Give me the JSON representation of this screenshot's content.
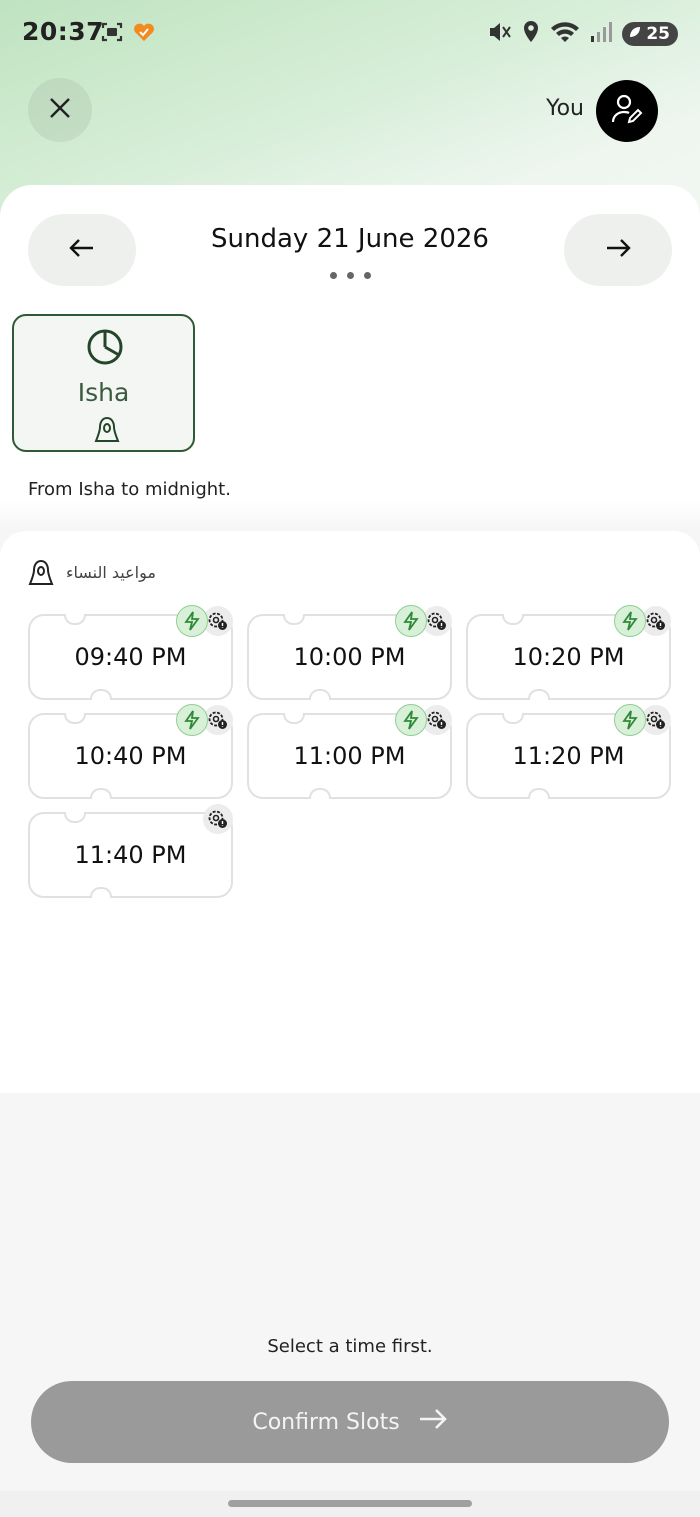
{
  "status_bar": {
    "time": "20:37",
    "battery": "25"
  },
  "header": {
    "user_label": "You"
  },
  "date_nav": {
    "title": "Sunday 21 June 2026"
  },
  "prayer": {
    "name": "Isha",
    "description": "From Isha to midnight."
  },
  "slots_section": {
    "label": "مواعيد النساء",
    "slots": [
      {
        "time": "09:40 PM",
        "instant": true
      },
      {
        "time": "10:00 PM",
        "instant": true
      },
      {
        "time": "10:20 PM",
        "instant": true
      },
      {
        "time": "10:40 PM",
        "instant": true
      },
      {
        "time": "11:00 PM",
        "instant": true
      },
      {
        "time": "11:20 PM",
        "instant": true
      },
      {
        "time": "11:40 PM",
        "instant": false
      }
    ]
  },
  "footer": {
    "hint": "Select a time first.",
    "confirm_label": "Confirm Slots"
  },
  "colors": {
    "accent": "#2e5a34",
    "disabled_button": "#9a9a9a",
    "bolt_green": "#3a9a42"
  }
}
